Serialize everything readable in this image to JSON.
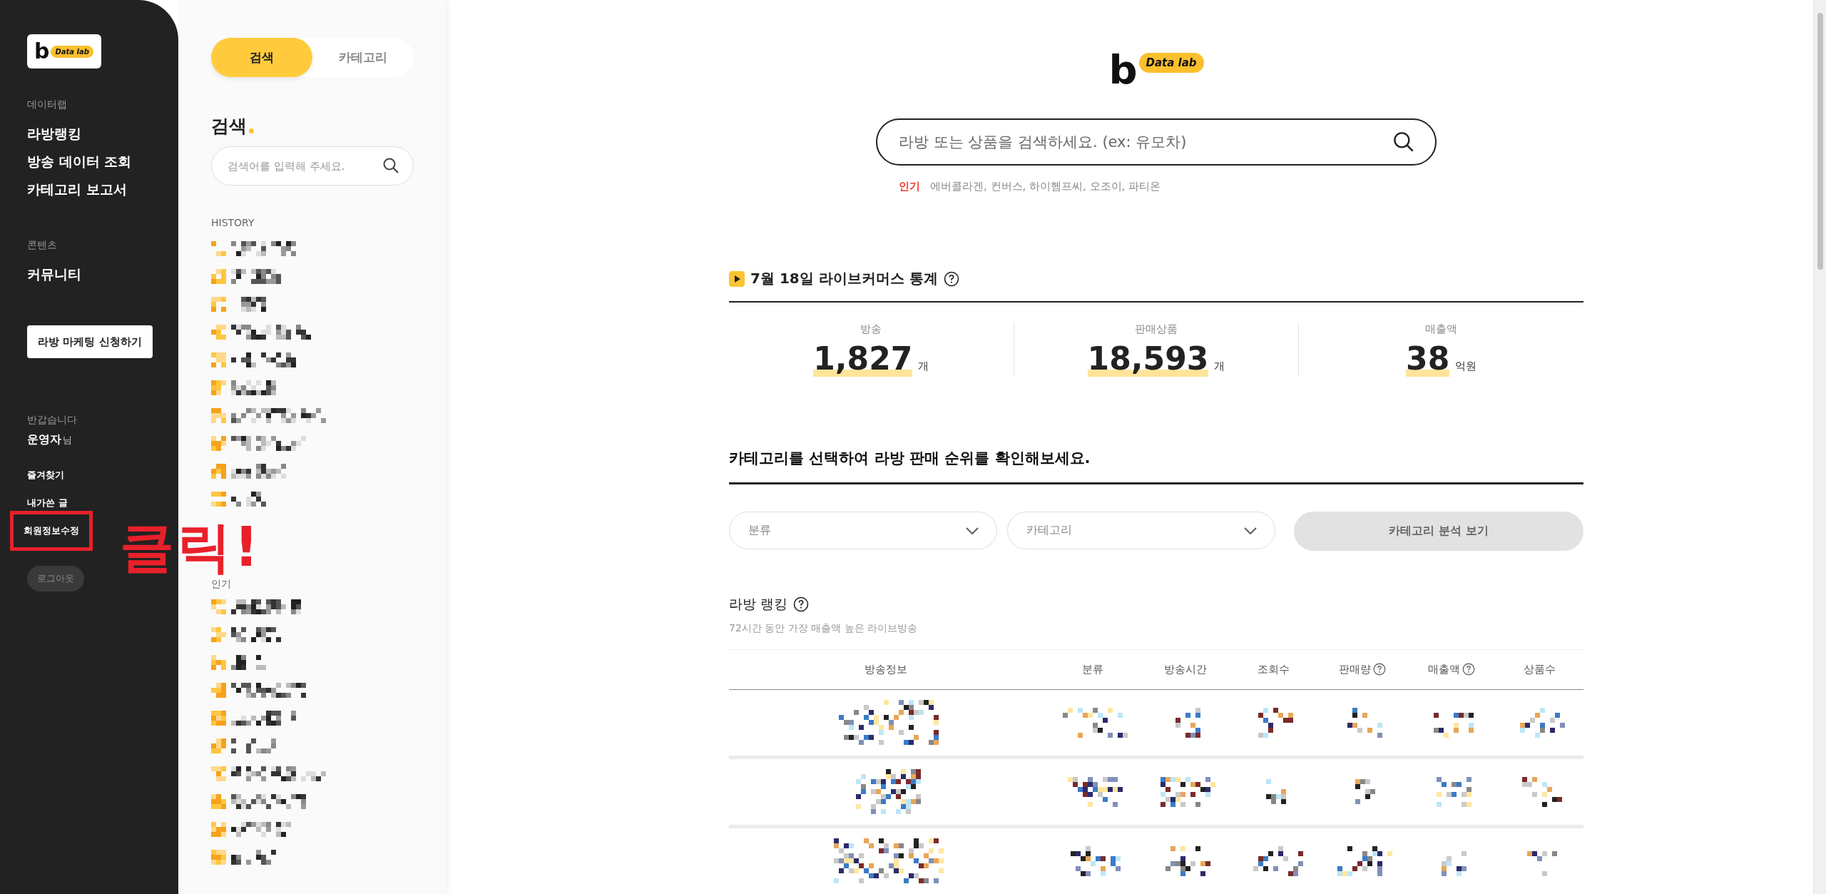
{
  "sidebar": {
    "logo_mark": "b",
    "logo_text": "Data lab",
    "sections": [
      {
        "heading": "데이터랩",
        "items": [
          "라방랭킹",
          "방송 데이터 조회",
          "카테고리 보고서"
        ]
      },
      {
        "heading": "콘텐츠",
        "items": [
          "커뮤니티"
        ]
      }
    ],
    "cta_button": "라방 마케팅 신청하기",
    "greeting": "반갑습니다",
    "user_name": "운영자",
    "honorific": "님",
    "account_links": [
      {
        "label": "즐겨찾기",
        "highlighted": false
      },
      {
        "label": "내가쓴 글",
        "highlighted": false
      },
      {
        "label": "회원정보수정",
        "highlighted": true
      }
    ],
    "logout": "로그아웃"
  },
  "annotation": {
    "text": "클릭!"
  },
  "search_panel": {
    "tabs": [
      {
        "label": "검색",
        "selected": true
      },
      {
        "label": "카테고리",
        "selected": false
      }
    ],
    "title": "검색",
    "search": {
      "placeholder": "검색어를 입력해 주세요."
    },
    "history_heading": "HISTORY",
    "history": [
      {
        "kind": "redacted"
      },
      {
        "kind": "redacted"
      },
      {
        "kind": "redacted"
      },
      {
        "kind": "redacted"
      },
      {
        "kind": "redacted"
      },
      {
        "kind": "redacted"
      },
      {
        "kind": "redacted"
      },
      {
        "kind": "redacted"
      },
      {
        "kind": "redacted"
      },
      {
        "kind": "redacted"
      }
    ],
    "popular_heading": "인기",
    "popular": [
      {
        "kind": "redacted"
      },
      {
        "kind": "redacted"
      },
      {
        "kind": "redacted"
      },
      {
        "kind": "redacted"
      },
      {
        "kind": "redacted"
      },
      {
        "kind": "redacted"
      },
      {
        "kind": "redacted"
      },
      {
        "kind": "redacted"
      },
      {
        "kind": "redacted"
      },
      {
        "kind": "redacted"
      }
    ]
  },
  "main": {
    "logo_mark": "b",
    "logo_text": "Data lab",
    "search": {
      "placeholder": "라방 또는 상품을 검색하세요. (ex: 유모차)"
    },
    "popular_label": "인기",
    "popular_terms": "에버콜라겐, 컨버스, 하이헴프씨, 오조이, 파티온",
    "stats": {
      "title": "7월 18일 라이브커머스 통계",
      "items": [
        {
          "label": "방송",
          "value": "1,827",
          "unit": "개"
        },
        {
          "label": "판매상품",
          "value": "18,593",
          "unit": "개"
        },
        {
          "label": "매출액",
          "value": "38",
          "unit": "억원"
        }
      ]
    },
    "category": {
      "title": "카테고리를 선택하여 라방 판매 순위를 확인해보세요.",
      "selects": [
        {
          "placeholder": "분류"
        },
        {
          "placeholder": "카테고리"
        }
      ],
      "button": "카테고리 분석 보기",
      "button_disabled": true
    },
    "ranking": {
      "title": "라방 랭킹",
      "subtitle": "72시간 동안 가장 매출액 높은 라이브방송",
      "columns": [
        {
          "label": "방송정보"
        },
        {
          "label": "분류"
        },
        {
          "label": "방송시간"
        },
        {
          "label": "조회수"
        },
        {
          "label": "판매량",
          "help": true
        },
        {
          "label": "매출액",
          "help": true
        },
        {
          "label": "상품수"
        }
      ],
      "rows": [
        {
          "kind": "redacted"
        },
        {
          "kind": "redacted"
        },
        {
          "kind": "redacted"
        }
      ]
    }
  }
}
